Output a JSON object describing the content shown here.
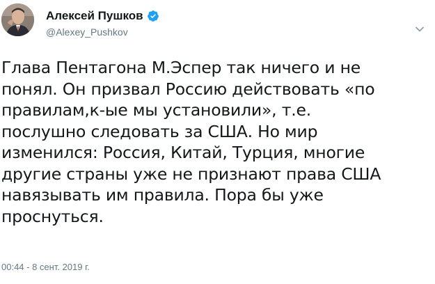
{
  "author": {
    "display_name": "Алексей Пушков",
    "handle": "@Alexey_Pushkov",
    "verified": true,
    "verified_color": "#1da1f2"
  },
  "tweet": {
    "text": "Глава Пентагона М.Эспер так ничего и не\nпонял. Он призвал Россию действовать «по\nправилам,к-ые мы установили», т.е.\nпослушно следовать за США. Но мир\nизменился: Россия, Китай, Турция, многие\nдругие страны уже не признают права США\nнавязывать им правила. Пора бы уже\nпроснуться.",
    "timestamp": "00:44 - 8 сент. 2019 г."
  },
  "icons": {
    "verified": "verified-badge-icon",
    "menu": "chevron-down-icon"
  },
  "colors": {
    "text": "#14171a",
    "secondary": "#657786"
  }
}
